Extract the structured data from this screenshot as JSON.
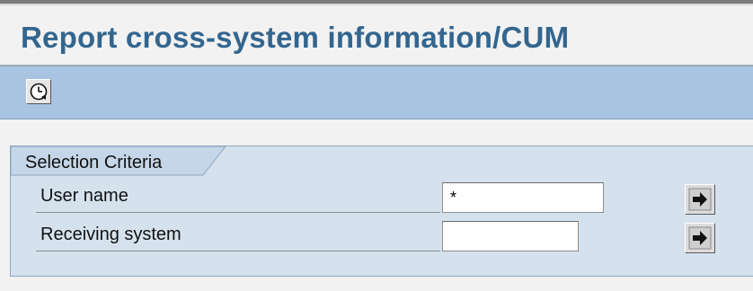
{
  "page": {
    "title": "Report cross-system information/CUM"
  },
  "toolbar": {
    "execute_icon": "execute-clock-icon"
  },
  "selection": {
    "group_title": "Selection Criteria",
    "fields": [
      {
        "label": "User name",
        "value": "*",
        "button_icon": "multiple-selection-arrow-icon"
      },
      {
        "label": "Receiving system",
        "value": "",
        "button_icon": "multiple-selection-arrow-icon"
      }
    ]
  },
  "colors": {
    "title": "#33668f",
    "toolbar": "#a9c4e2",
    "group_background": "#d5e2ee"
  }
}
